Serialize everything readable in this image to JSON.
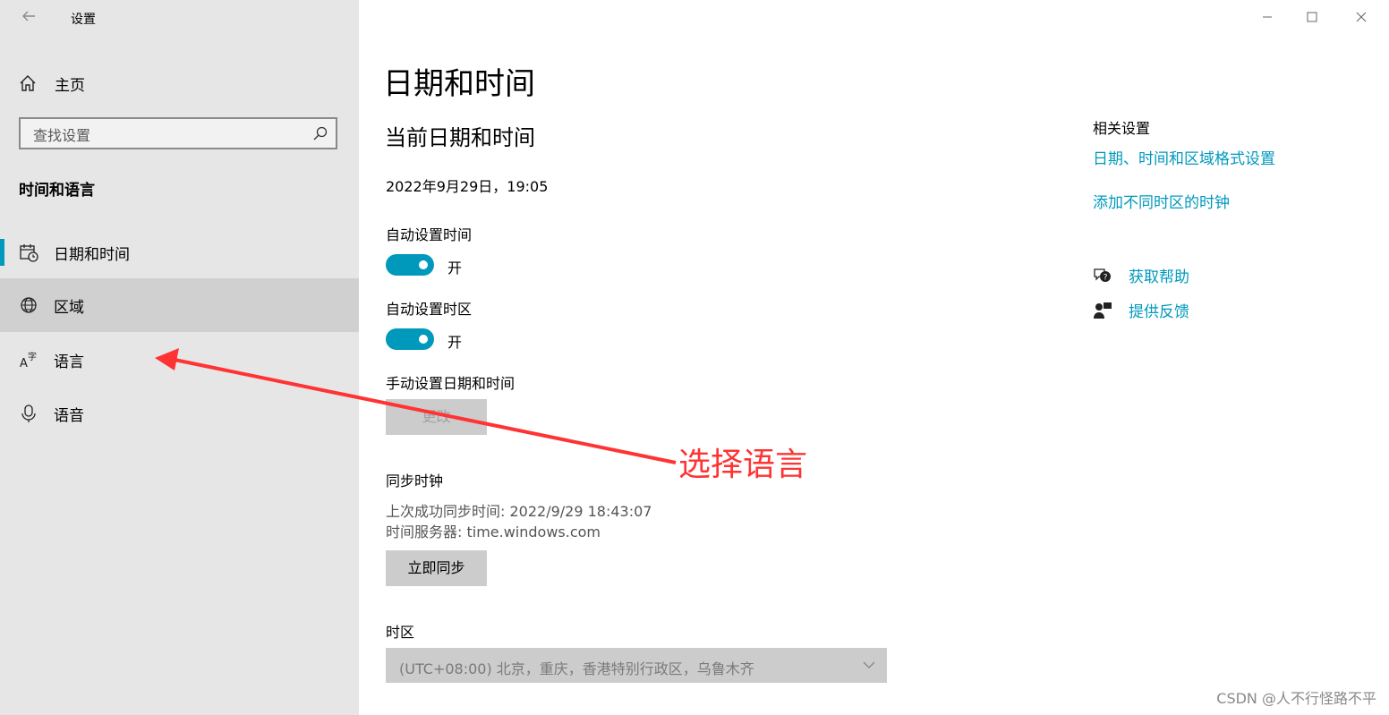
{
  "window": {
    "title": "设置"
  },
  "sidebar": {
    "home_label": "主页",
    "search": {
      "placeholder": "查找设置"
    },
    "section_title": "时间和语言",
    "items": [
      {
        "label": "日期和时间",
        "icon": "calendar-clock-icon",
        "active": true
      },
      {
        "label": "区域",
        "icon": "globe-icon"
      },
      {
        "label": "语言",
        "icon": "language-icon"
      },
      {
        "label": "语音",
        "icon": "microphone-icon"
      }
    ]
  },
  "main": {
    "page_title": "日期和时间",
    "sub_title": "当前日期和时间",
    "current_datetime": "2022年9月29日，19:05",
    "auto_time": {
      "label": "自动设置时间",
      "state": "开"
    },
    "auto_timezone": {
      "label": "自动设置时区",
      "state": "开"
    },
    "manual": {
      "label": "手动设置日期和时间",
      "button": "更改"
    },
    "sync": {
      "title": "同步时钟",
      "last_sync": "上次成功同步时间: 2022/9/29 18:43:07",
      "server": "时间服务器: time.windows.com",
      "button": "立即同步"
    },
    "timezone": {
      "label": "时区",
      "value": "(UTC+08:00) 北京，重庆，香港特别行政区，乌鲁木齐"
    }
  },
  "related": {
    "heading": "相关设置",
    "links": [
      "日期、时间和区域格式设置",
      "添加不同时区的时钟"
    ],
    "help": "获取帮助",
    "feedback": "提供反馈"
  },
  "annotation": {
    "text": "选择语言",
    "color": "#ff3333"
  },
  "watermark": "CSDN @人不行怪路不平",
  "colors": {
    "accent": "#0099bc",
    "sidebar_bg": "#e6e6e6"
  }
}
